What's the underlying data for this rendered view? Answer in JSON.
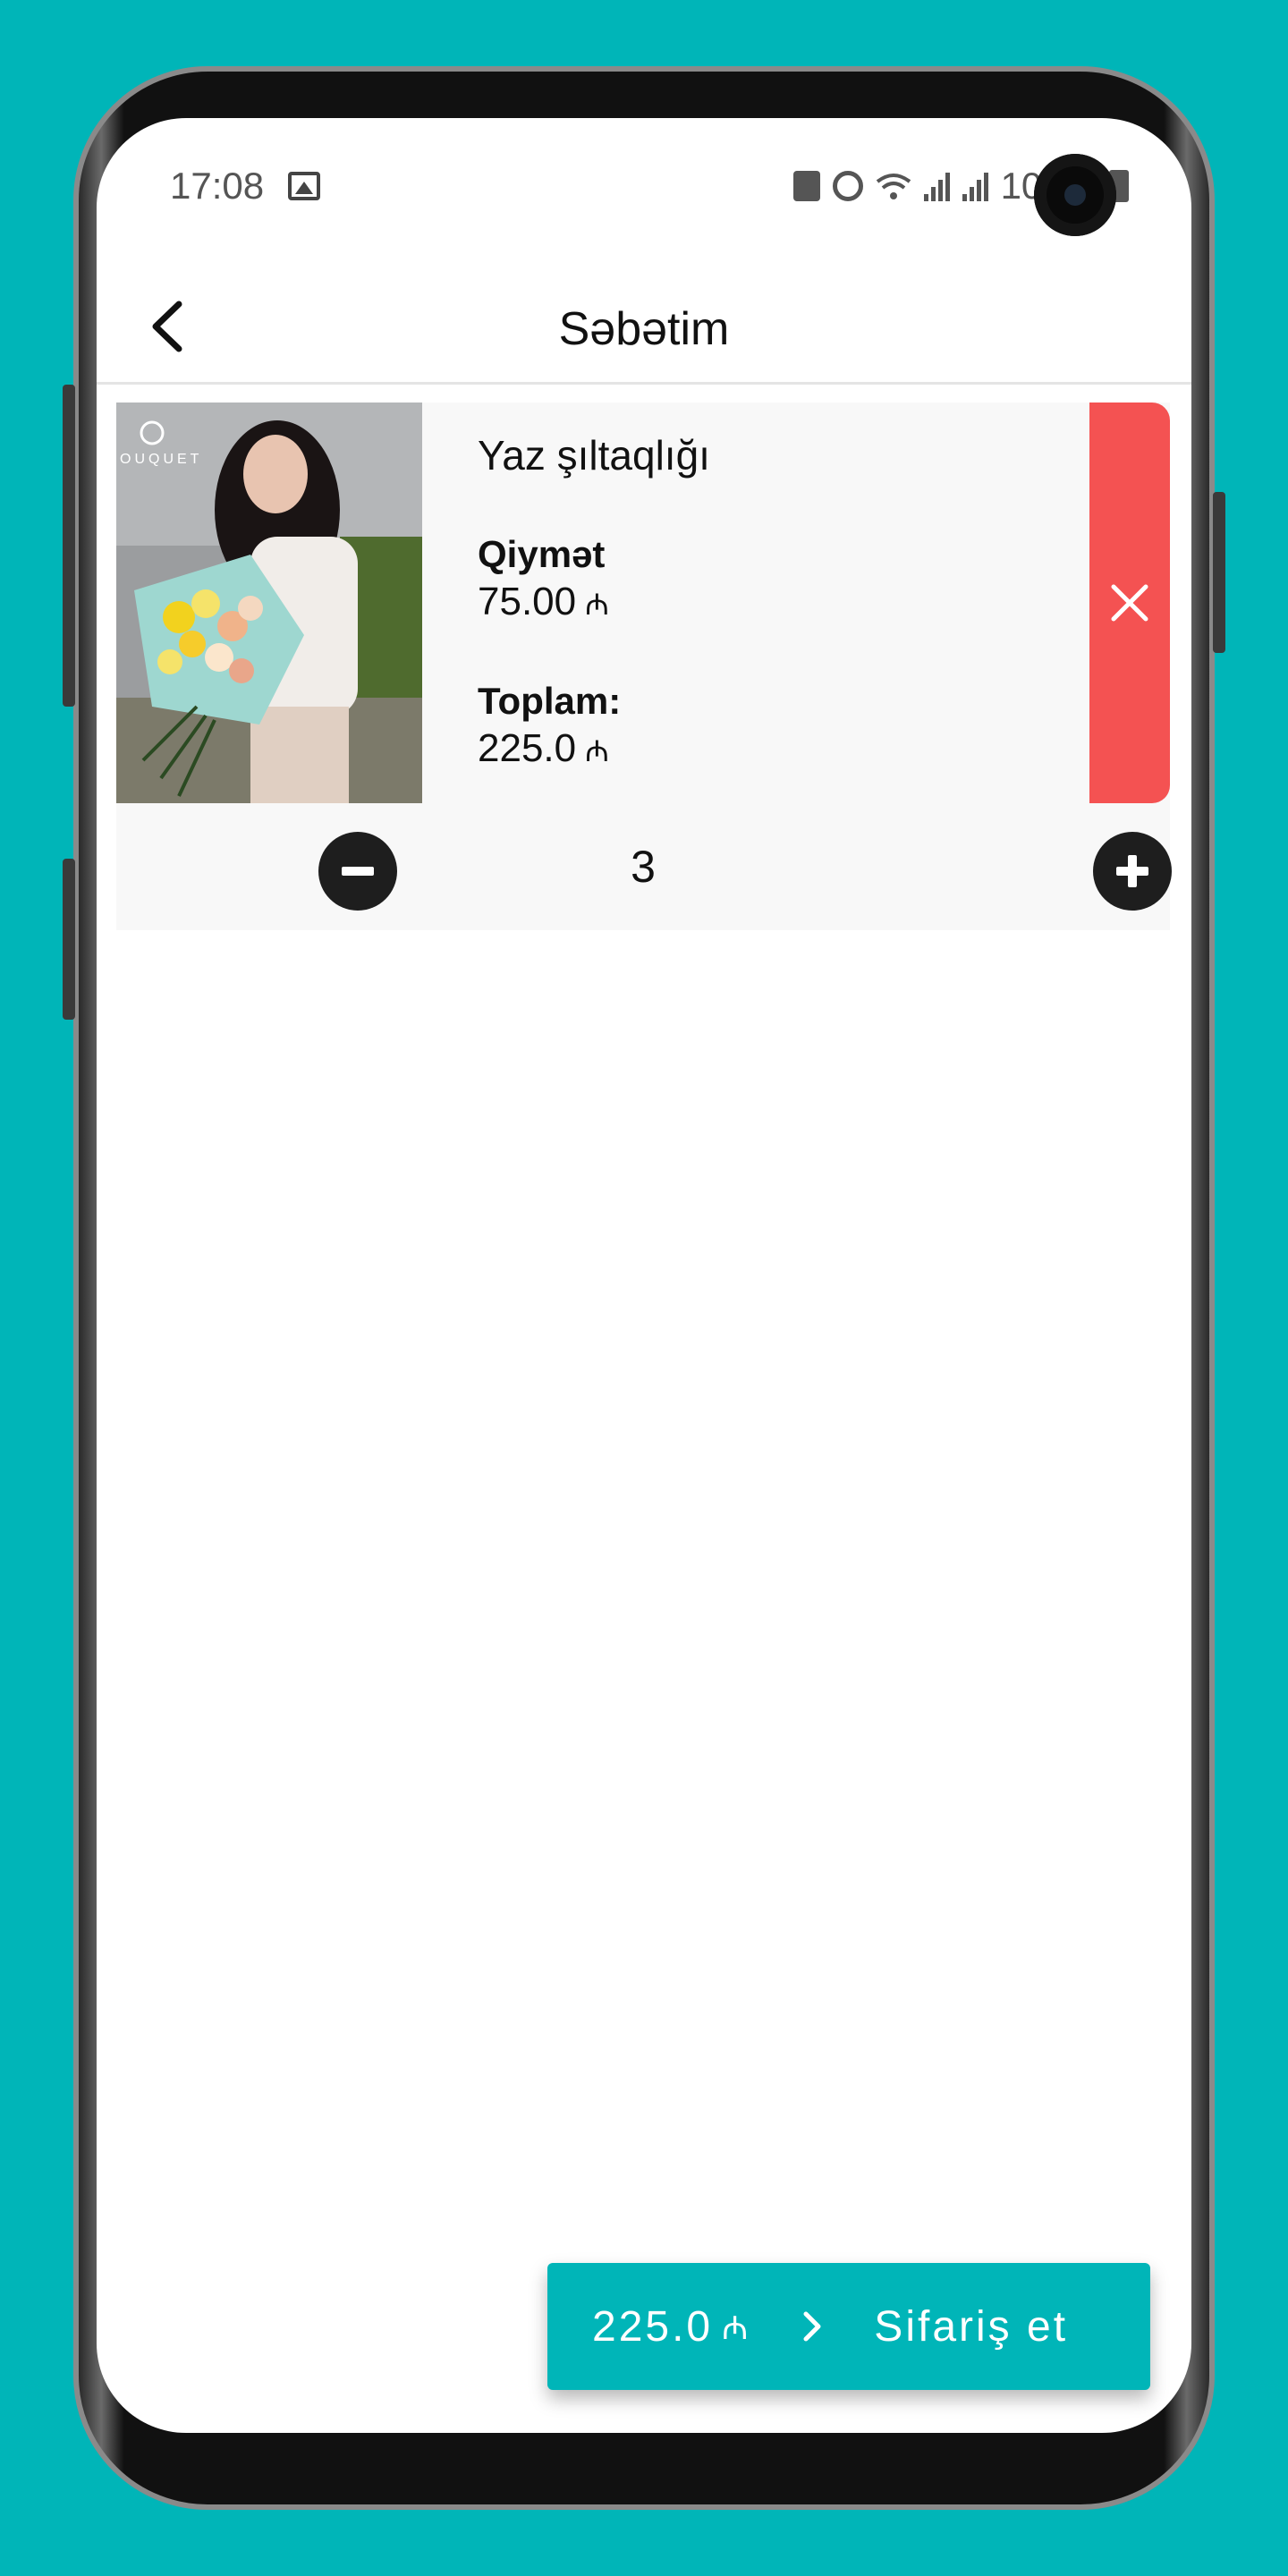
{
  "status_bar": {
    "time": "17:08",
    "battery": "100%"
  },
  "header": {
    "title": "Səbətim"
  },
  "cart": {
    "item": {
      "name": "Yaz şıltaqlığı",
      "price_label": "Qiymət",
      "price_value": "75.00",
      "total_label": "Toplam:",
      "total_value": "225.0",
      "currency": "₼",
      "quantity": "3",
      "photo_logo": "OUQUET"
    }
  },
  "checkout": {
    "total": "225.0",
    "currency": "₼",
    "label": "Sifariş et"
  },
  "colors": {
    "accent": "#00b5b8",
    "delete": "#f45252",
    "background": "#ffffff"
  }
}
